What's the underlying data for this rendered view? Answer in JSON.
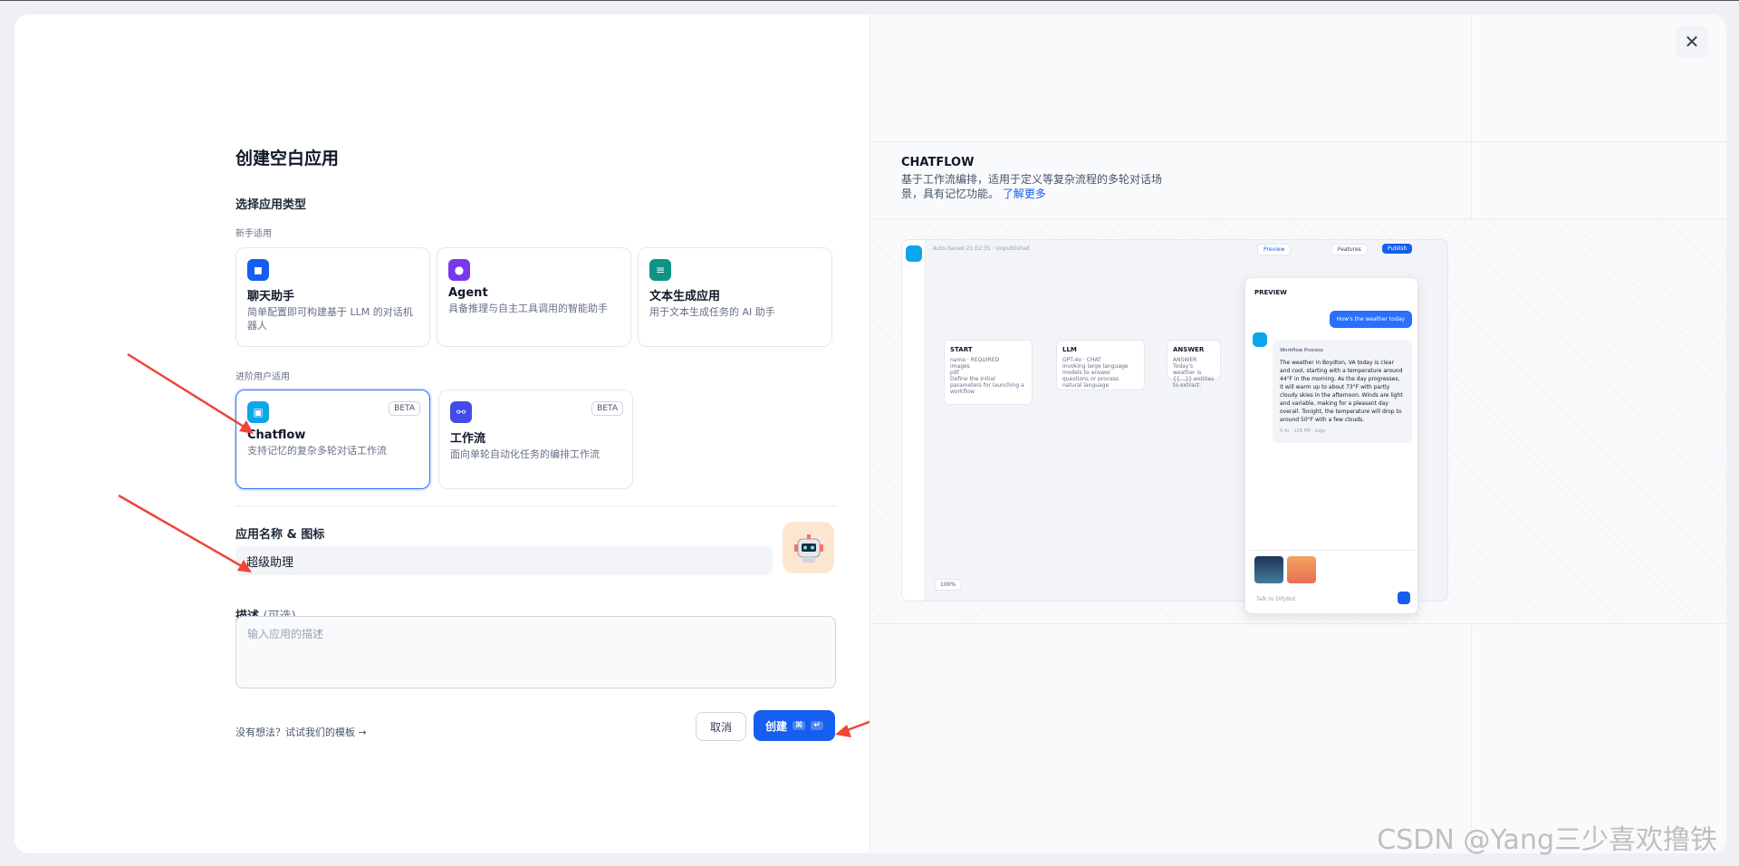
{
  "modal": {
    "title": "创建空白应用",
    "close_label": "✕",
    "type_section": "选择应用类型",
    "beginner_label": "新手适用",
    "advanced_label": "进阶用户适用",
    "cards_beginner": [
      {
        "name": "聊天助手",
        "desc": "简单配置即可构建基于 LLM 的对话机器人",
        "color": "#155eef",
        "icon": "chat-bot-icon"
      },
      {
        "name": "Agent",
        "desc": "具备推理与自主工具调用的智能助手",
        "color": "#7839ee",
        "icon": "agent-icon"
      },
      {
        "name": "文本生成应用",
        "desc": "用于文本生成任务的 AI 助手",
        "color": "#0e9384",
        "icon": "text-generation-icon"
      }
    ],
    "cards_advanced": [
      {
        "name": "Chatflow",
        "desc": "支持记忆的复杂多轮对话工作流",
        "badge": "BETA",
        "color": "#0ba5ec",
        "icon": "chatflow-icon"
      },
      {
        "name": "工作流",
        "desc": "面向单轮自动化任务的编排工作流",
        "badge": "BETA",
        "color": "#444ce7",
        "icon": "workflow-icon"
      }
    ],
    "name_section": "应用名称 & 图标",
    "name_value": "超级助理",
    "desc_section": "描述",
    "desc_optional": "(可选)",
    "desc_placeholder": "输入应用的描述",
    "template_link": "没有想法？试试我们的模板",
    "cancel_label": "取消",
    "create_label": "创建",
    "create_kbd1": "⌘",
    "create_kbd2": "↵"
  },
  "preview": {
    "title": "CHATFLOW",
    "desc": "基于工作流编排，适用于定义等复杂流程的多轮对话场景，具有记忆功能。",
    "learn_more": "了解更多",
    "shot": {
      "autosave": "Auto-Saved 21:02:35 · Unpublished",
      "preview_btn": "Preview",
      "features_btn": "Features",
      "publish_btn": "Publish",
      "start_node": "START",
      "start_fields": [
        "name",
        "images",
        "pdf"
      ],
      "required": "REQUIRED",
      "start_desc": "Define the initial parameters for launching a workflow",
      "llm_node": "LLM",
      "llm_model": "GPT-4o",
      "llm_chat": "CHAT",
      "llm_desc": "Invoking large language models to answer questions or process natural language",
      "answer_node": "ANSWER",
      "answer_label": "ANSWER",
      "answer_desc": "Today's weather is {{...}} entities to extract.",
      "zoom": "100%",
      "panel_title": "PREVIEW",
      "user_msg": "How's the weather today",
      "workflow_process": "Workflow Process",
      "answer_text": "The weather in Boydton, VA today is clear and cool, starting with a temperature around 44°F in the morning. As the day progresses, it will warm up to about 73°F with partly cloudy skies in the afternoon. Winds are light and variable, making for a pleasant day overall. Tonight, the temperature will drop to around 50°F with a few clouds.",
      "timestamp": "5.4s · 129 PM",
      "logs": "Logs",
      "input_placeholder": "Talk to DifyBot"
    }
  },
  "watermark": "CSDN @Yang三少喜欢撸铁"
}
